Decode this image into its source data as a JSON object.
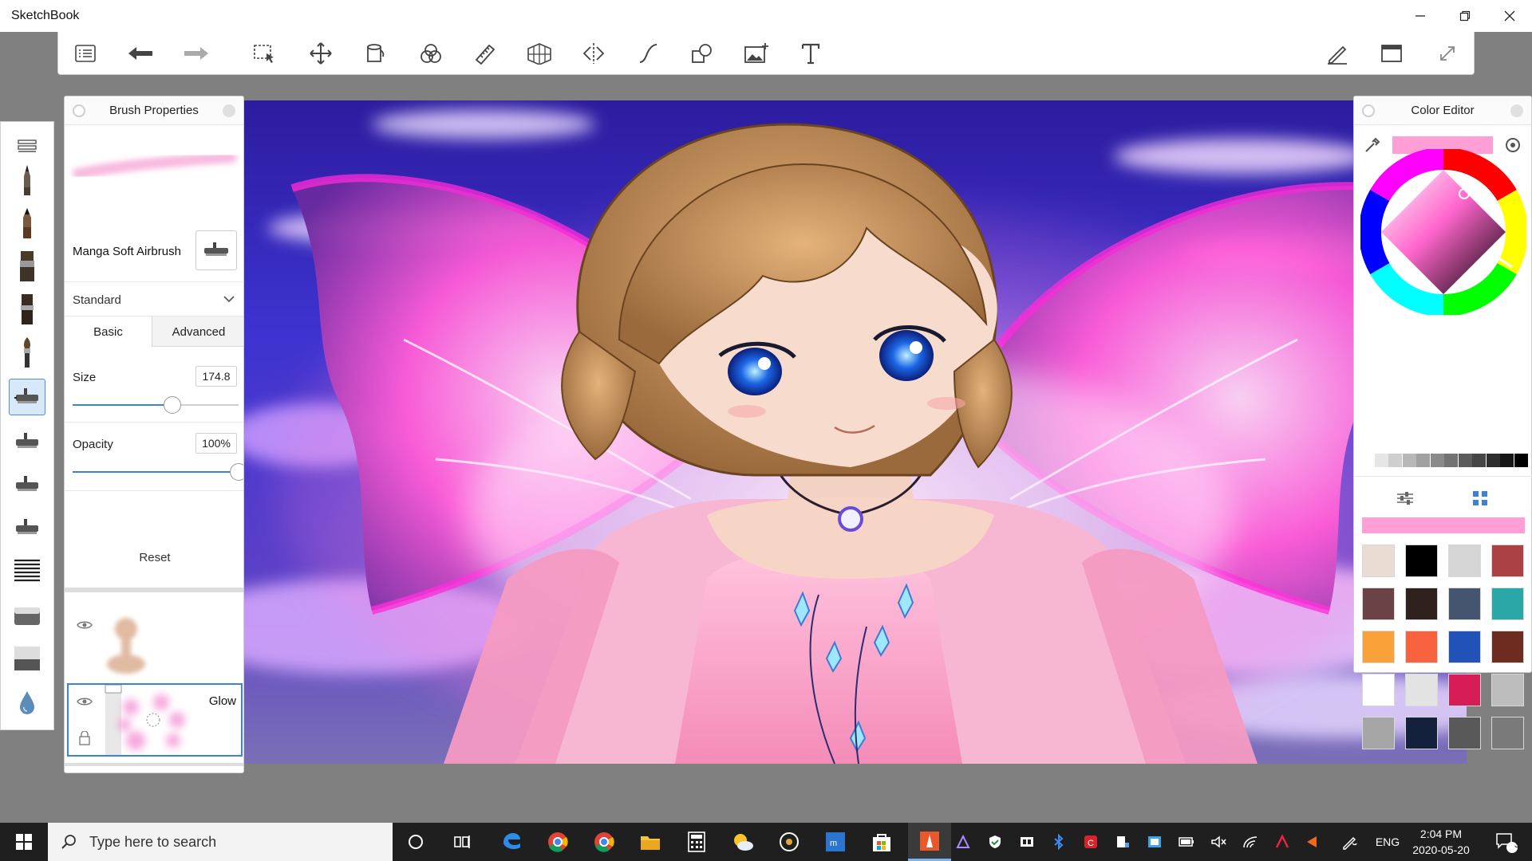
{
  "app": {
    "title": "SketchBook"
  },
  "window_controls": {
    "minimize": "minimize",
    "restore": "restore",
    "close": "close"
  },
  "brush_panel": {
    "title": "Brush Properties",
    "brush_name": "Manga Soft Airbrush",
    "preset": "Standard",
    "tabs": [
      "Basic",
      "Advanced"
    ],
    "size_label": "Size",
    "size_value": "174.8",
    "size_fraction": 0.6,
    "opacity_label": "Opacity",
    "opacity_value": "100%",
    "opacity_fraction": 1.0,
    "reset_label": "Reset"
  },
  "layers": [
    {
      "name": "",
      "visible": true
    },
    {
      "name": "Glow",
      "visible": true,
      "selected": true
    }
  ],
  "color_editor": {
    "title": "Color Editor",
    "current_color": "#ff9fd6",
    "palette": [
      "#eadcd2",
      "#000000",
      "#d5d5d5",
      "#ac4145",
      "#6b4245",
      "#31211e",
      "#46556f",
      "#2aa8a8",
      "#f9a23a",
      "#f7633f",
      "#2052b8",
      "#6e2b1f",
      "#ffffff",
      "#e3e3e3",
      "#d61d57",
      "#bdbdbd",
      "#a6a6a6",
      "#13213d",
      "#595959",
      "#7a7a7a"
    ],
    "grays": [
      "#ffffff",
      "#e6e6e6",
      "#cfcfcf",
      "#b8b8b8",
      "#a1a1a1",
      "#8a8a8a",
      "#737373",
      "#5c5c5c",
      "#454545",
      "#2e2e2e",
      "#171717",
      "#000000"
    ]
  },
  "taskbar": {
    "search_placeholder": "Type here to search",
    "language": "ENG",
    "time": "2:04 PM",
    "date": "2020-05-20",
    "notification_count": "3"
  }
}
